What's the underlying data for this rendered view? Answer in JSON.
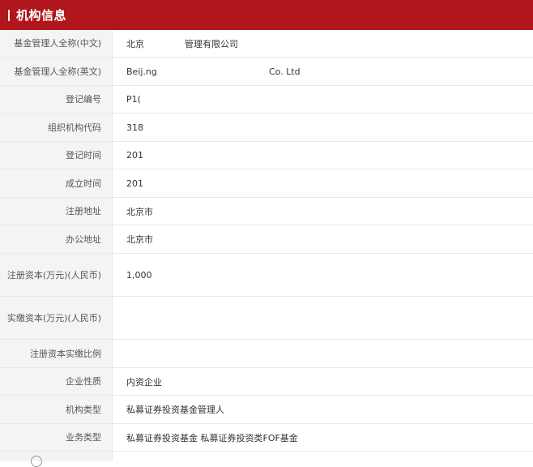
{
  "header": {
    "title": "机构信息"
  },
  "rows": [
    {
      "label": "基金管理人全称(中文)",
      "value": "北京",
      "value2": "管理有限公司"
    },
    {
      "label": "基金管理人全称(英文)",
      "value": "Beij.ng",
      "value2": "Co. Ltd"
    },
    {
      "label": "登记编号",
      "value": "P1("
    },
    {
      "label": "组织机构代码",
      "value": "318"
    },
    {
      "label": "登记时间",
      "value": "201"
    },
    {
      "label": "成立时间",
      "value": "201"
    },
    {
      "label": "注册地址",
      "value": "北京市"
    },
    {
      "label": "办公地址",
      "value": "北京市"
    },
    {
      "label": "注册资本(万元)(人民币)",
      "value": "1,000"
    },
    {
      "label": "实缴资本(万元)(人民币)",
      "value": ""
    },
    {
      "label": "注册资本实缴比例",
      "value": ""
    },
    {
      "label": "企业性质",
      "value": "内资企业"
    },
    {
      "label": "机构类型",
      "value": "私募证券投资基金管理人"
    },
    {
      "label": "业务类型",
      "value": "私募证券投资基金  私募证券投资类FOF基金"
    }
  ],
  "colors": {
    "header_bg": "#b1161c",
    "label_bg": "#f4f4f4"
  }
}
